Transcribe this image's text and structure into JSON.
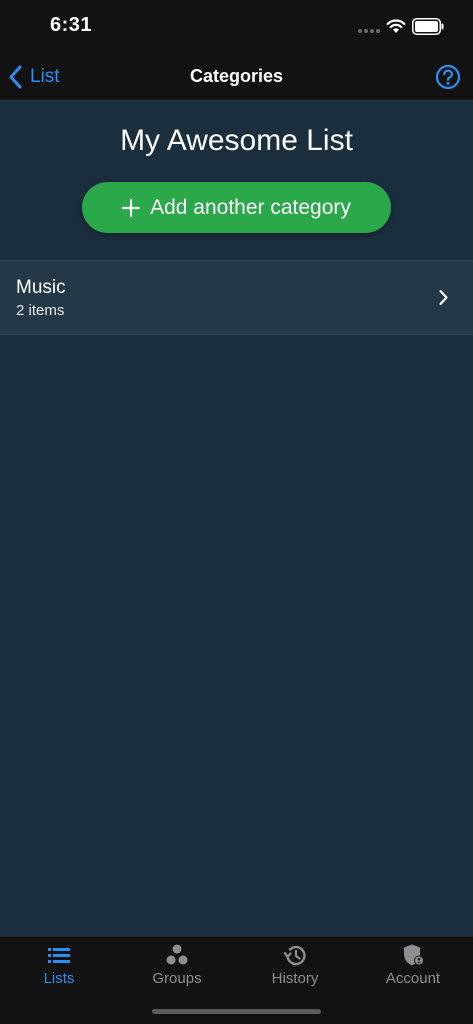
{
  "status_bar": {
    "time": "6:31"
  },
  "nav": {
    "back_label": "List",
    "title": "Categories",
    "help_icon": "question-circle-icon"
  },
  "list": {
    "title": "My Awesome List",
    "add_button_label": "Add another category"
  },
  "categories": [
    {
      "name": "Music",
      "count": "2 items"
    }
  ],
  "tabs": [
    {
      "label": "Lists",
      "icon": "list-icon",
      "active": true
    },
    {
      "label": "Groups",
      "icon": "groups-icon",
      "active": false
    },
    {
      "label": "History",
      "icon": "history-icon",
      "active": false
    },
    {
      "label": "Account",
      "icon": "account-shield-icon",
      "active": false
    }
  ],
  "colors": {
    "accent": "#2a8ff7",
    "add_button": "#2aa84a",
    "background": "#1b2e3e",
    "row": "#243847",
    "bar": "#121212",
    "tab_inactive": "#8e8e93"
  }
}
